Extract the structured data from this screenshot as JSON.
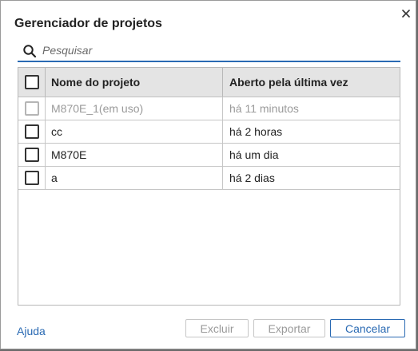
{
  "dialog": {
    "title": "Gerenciador de projetos",
    "close_icon": "close-icon"
  },
  "search": {
    "placeholder": "Pesquisar",
    "value": "",
    "icon": "search-icon"
  },
  "table": {
    "columns": [
      "Nome do projeto",
      "Aberto pela última vez"
    ],
    "rows": [
      {
        "name": "M870E_1(em uso)",
        "opened": "há 11 minutos",
        "disabled": true
      },
      {
        "name": "cc",
        "opened": "há 2 horas",
        "disabled": false
      },
      {
        "name": "M870E",
        "opened": "há um dia",
        "disabled": false
      },
      {
        "name": "a",
        "opened": "há 2 dias",
        "disabled": false
      }
    ]
  },
  "footer": {
    "help_label": "Ajuda",
    "delete_label": "Excluir",
    "export_label": "Exportar",
    "cancel_label": "Cancelar"
  },
  "colors": {
    "accent": "#2a6ab3",
    "header_bg": "#e4e4e4",
    "disabled_text": "#9a9a9a"
  }
}
